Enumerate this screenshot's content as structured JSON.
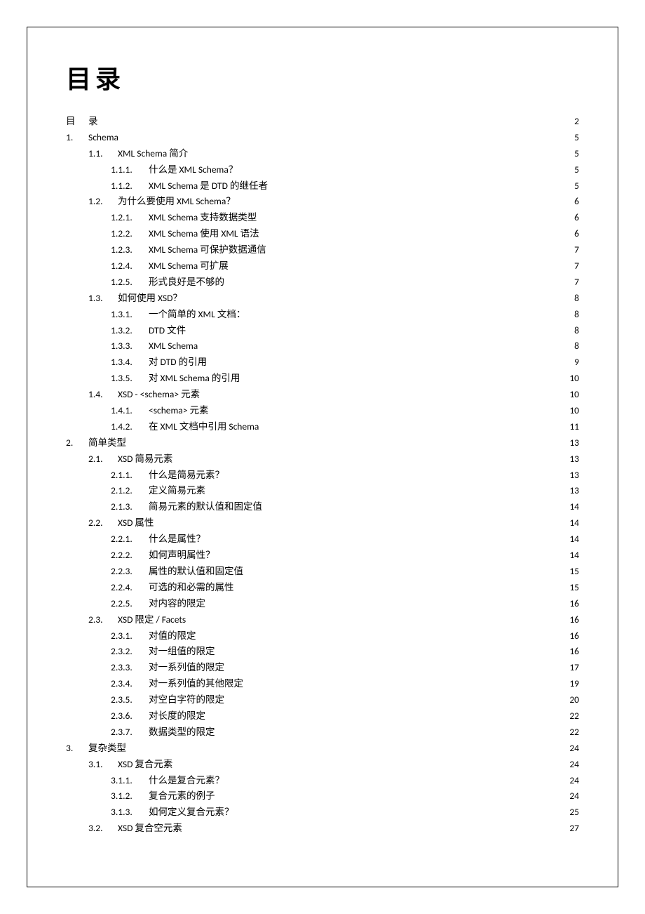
{
  "title": "目录",
  "toc": [
    {
      "level": 0,
      "num": "目",
      "label": "录",
      "page": "2"
    },
    {
      "level": 0,
      "num": "1.",
      "label": "Schema",
      "page": "5"
    },
    {
      "level": 1,
      "num": "1.1.",
      "label": "XML Schema  简介",
      "page": "5"
    },
    {
      "level": 2,
      "num": "1.1.1.",
      "label": "什么是  XML Schema？",
      "page": "5"
    },
    {
      "level": 2,
      "num": "1.1.2.",
      "label": "XML Schema  是  DTD  的继任者",
      "page": "5"
    },
    {
      "level": 1,
      "num": "1.2.",
      "label": "为什么要使用  XML Schema？",
      "page": "6"
    },
    {
      "level": 2,
      "num": "1.2.1.",
      "label": "XML Schema  支持数据类型",
      "page": "6"
    },
    {
      "level": 2,
      "num": "1.2.2.",
      "label": "XML Schema  使用  XML  语法",
      "page": "6"
    },
    {
      "level": 2,
      "num": "1.2.3.",
      "label": "XML Schema  可保护数据通信",
      "page": "7"
    },
    {
      "level": 2,
      "num": "1.2.4.",
      "label": "XML Schema  可扩展",
      "page": "7"
    },
    {
      "level": 2,
      "num": "1.2.5.",
      "label": "形式良好是不够的",
      "page": "7"
    },
    {
      "level": 1,
      "num": "1.3.",
      "label": "如何使用  XSD？",
      "page": "8"
    },
    {
      "level": 2,
      "num": "1.3.1.",
      "label": "一个简单的  XML  文档：",
      "page": "8"
    },
    {
      "level": 2,
      "num": "1.3.2.",
      "label": "DTD  文件",
      "page": "8"
    },
    {
      "level": 2,
      "num": "1.3.3.",
      "label": "XML Schema",
      "page": "8"
    },
    {
      "level": 2,
      "num": "1.3.4.",
      "label": "对  DTD  的引用",
      "page": "9"
    },
    {
      "level": 2,
      "num": "1.3.5.",
      "label": "对  XML Schema  的引用",
      "page": "10"
    },
    {
      "level": 1,
      "num": "1.4.",
      "label": "XSD - <schema>  元素",
      "page": "10"
    },
    {
      "level": 2,
      "num": "1.4.1.",
      "label": "<schema>  元素",
      "page": "10"
    },
    {
      "level": 2,
      "num": "1.4.2.",
      "label": "在  XML  文档中引用  Schema",
      "page": "11"
    },
    {
      "level": 0,
      "num": "2.",
      "label": "简单类型",
      "page": "13"
    },
    {
      "level": 1,
      "num": "2.1.",
      "label": "XSD  简易元素",
      "page": "13"
    },
    {
      "level": 2,
      "num": "2.1.1.",
      "label": "什么是简易元素？",
      "page": "13"
    },
    {
      "level": 2,
      "num": "2.1.2.",
      "label": "定义简易元素",
      "page": "13"
    },
    {
      "level": 2,
      "num": "2.1.3.",
      "label": "简易元素的默认值和固定值",
      "page": "14"
    },
    {
      "level": 1,
      "num": "2.2.",
      "label": "XSD  属性",
      "page": "14"
    },
    {
      "level": 2,
      "num": "2.2.1.",
      "label": "什么是属性？",
      "page": "14"
    },
    {
      "level": 2,
      "num": "2.2.2.",
      "label": "如何声明属性？",
      "page": "14"
    },
    {
      "level": 2,
      "num": "2.2.3.",
      "label": "属性的默认值和固定值",
      "page": "15"
    },
    {
      "level": 2,
      "num": "2.2.4.",
      "label": "可选的和必需的属性",
      "page": "15"
    },
    {
      "level": 2,
      "num": "2.2.5.",
      "label": "对内容的限定",
      "page": "16"
    },
    {
      "level": 1,
      "num": "2.3.",
      "label": "XSD  限定  / Facets",
      "page": "16"
    },
    {
      "level": 2,
      "num": "2.3.1.",
      "label": "对值的限定",
      "page": "16"
    },
    {
      "level": 2,
      "num": "2.3.2.",
      "label": "对一组值的限定",
      "page": "16"
    },
    {
      "level": 2,
      "num": "2.3.3.",
      "label": "对一系列值的限定",
      "page": "17"
    },
    {
      "level": 2,
      "num": "2.3.4.",
      "label": "对一系列值的其他限定",
      "page": "19"
    },
    {
      "level": 2,
      "num": "2.3.5.",
      "label": "对空白字符的限定",
      "page": "20"
    },
    {
      "level": 2,
      "num": "2.3.6.",
      "label": "对长度的限定",
      "page": "22"
    },
    {
      "level": 2,
      "num": "2.3.7.",
      "label": "数据类型的限定",
      "page": "22"
    },
    {
      "level": 0,
      "num": "3.",
      "label": "复杂类型",
      "page": "24"
    },
    {
      "level": 1,
      "num": "3.1.",
      "label": "XSD  复合元素",
      "page": "24"
    },
    {
      "level": 2,
      "num": "3.1.1.",
      "label": "什么是复合元素？",
      "page": "24"
    },
    {
      "level": 2,
      "num": "3.1.2.",
      "label": "复合元素的例子",
      "page": "24"
    },
    {
      "level": 2,
      "num": "3.1.3.",
      "label": "如何定义复合元素？",
      "page": "25"
    },
    {
      "level": 1,
      "num": "3.2.",
      "label": "XSD  复合空元素",
      "page": "27"
    }
  ]
}
